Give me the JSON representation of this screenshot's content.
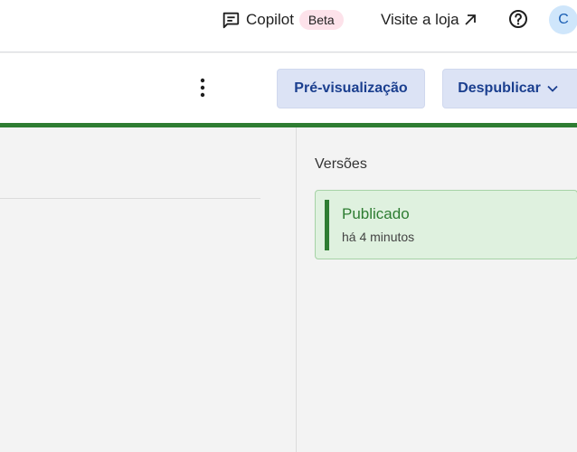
{
  "header": {
    "copilot_label": "Copilot",
    "beta_badge": "Beta",
    "visit_store_label": "Visite a loja",
    "avatar_initial": "C"
  },
  "toolbar": {
    "preview_label": "Pré-visualização",
    "unpublish_label": "Despublicar"
  },
  "versions": {
    "title": "Versões",
    "items": [
      {
        "status": "Publicado",
        "time": "há 4 minutos"
      }
    ]
  },
  "colors": {
    "accent_green": "#2e7d32",
    "button_bg": "#dce3f5",
    "button_text": "#1b3f8f",
    "card_bg": "#dff1df"
  },
  "icons": {
    "copilot": "chat-bubble-icon",
    "visit_store": "arrow-up-right-icon",
    "help": "help-circle-icon",
    "kebab": "more-vertical-icon",
    "chevron": "chevron-down-icon"
  }
}
